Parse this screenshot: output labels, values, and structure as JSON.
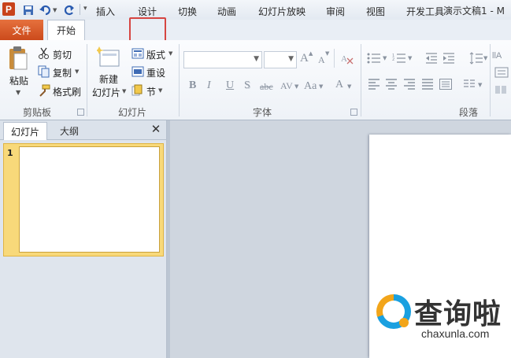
{
  "app": {
    "logo": "P",
    "title": "演示文稿1 - M"
  },
  "quick_access": {
    "save_icon": "save-icon",
    "undo_icon": "undo-icon",
    "redo_icon": "redo-icon"
  },
  "tabs": [
    {
      "label": "文件"
    },
    {
      "label": "开始"
    },
    {
      "label": "插入"
    },
    {
      "label": "设计"
    },
    {
      "label": "切换"
    },
    {
      "label": "动画"
    },
    {
      "label": "幻灯片放映"
    },
    {
      "label": "审阅"
    },
    {
      "label": "视图"
    },
    {
      "label": "开发工具"
    }
  ],
  "ribbon": {
    "clipboard": {
      "paste": "粘贴",
      "cut": "剪切",
      "copy": "复制",
      "format_painter": "格式刷",
      "label": "剪贴板"
    },
    "slides": {
      "new_slide_line1": "新建",
      "new_slide_line2": "幻灯片",
      "layout": "版式",
      "reset": "重设",
      "section": "节",
      "label": "幻灯片"
    },
    "font": {
      "label": "字体",
      "grow": "A",
      "shrink": "A",
      "bold": "B",
      "italic": "I",
      "underline": "U",
      "shadow": "S",
      "strike": "abc",
      "spacing": "AV",
      "case": "Aa",
      "color": "A"
    },
    "paragraph": {
      "label": "段落"
    }
  },
  "pane": {
    "tab_slides": "幻灯片",
    "tab_outline": "大纲",
    "close": "✕",
    "slide_number": "1"
  },
  "watermark": {
    "text": "查询啦",
    "url": "chaxunla.com"
  },
  "colors": {
    "file_tab": "#cc4a1b",
    "highlight": "#d64541",
    "thumb_selected": "#f8d97a"
  }
}
